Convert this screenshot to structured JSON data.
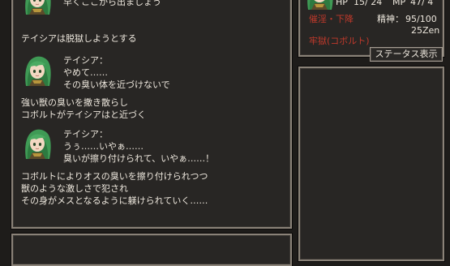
{
  "log": {
    "line_top": "早くここから出ましょう",
    "narr1": "テイシアは脱獄しようとする",
    "speaker1": "テイシア：",
    "speech1a": "やめて……",
    "speech1b": "その臭い体を近づけないで",
    "narr2a": "強い獣の臭いを撒き散らし",
    "narr2b": "コボルトがテイシアはと近づく",
    "speaker2": "テイシア：",
    "speech2a": "うぅ……いやぁ……",
    "speech2b": "臭いが擦り付けられて、いやぁ……！",
    "narr3a": "コボルトによりオスの臭いを擦り付けられつつ",
    "narr3b": "獣のような激しさで犯され",
    "narr3c": "その身がメスとなるように躾けられていく……"
  },
  "status": {
    "hp_label": "HP",
    "hp_value": "15/ 24",
    "mp_label": "MP",
    "mp_value": "47/ 4",
    "condition": "催淫・下降",
    "spirit_label": "精神：",
    "spirit_value": "95/100",
    "money": "25Zen",
    "location": "牢獄(コボルト)"
  },
  "buttons": {
    "status_display": "ステータス表示"
  },
  "colors": {
    "panel_bg": "#282624",
    "panel_border": "#8a8278",
    "text": "#ece6dc",
    "alert": "#c0392b"
  }
}
